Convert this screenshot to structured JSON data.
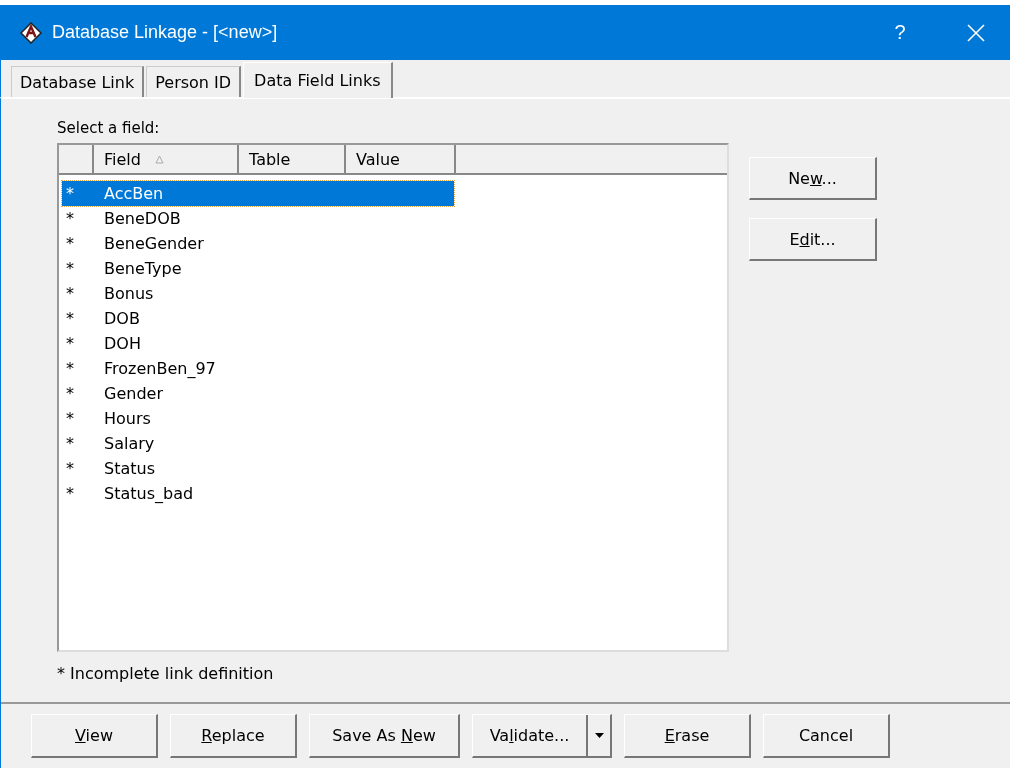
{
  "window": {
    "title": "Database Linkage - [<new>]",
    "help": "?"
  },
  "tabs": [
    {
      "label": "Database Link",
      "selected": false
    },
    {
      "label": "Person ID",
      "selected": false
    },
    {
      "label": "Data Field Links",
      "selected": true
    }
  ],
  "list_label": "Select a field:",
  "table": {
    "columns": [
      {
        "sorted": false
      },
      {
        "label": "Field",
        "sorted": true
      },
      {
        "label": "Table",
        "sorted": false
      },
      {
        "label": "Value",
        "sorted": false
      }
    ],
    "rows": [
      {
        "marker": "*",
        "field": "AccBen",
        "selected": true
      },
      {
        "marker": "*",
        "field": "BeneDOB",
        "selected": false
      },
      {
        "marker": "*",
        "field": "BeneGender",
        "selected": false
      },
      {
        "marker": "*",
        "field": "BeneType",
        "selected": false
      },
      {
        "marker": "*",
        "field": "Bonus",
        "selected": false
      },
      {
        "marker": "*",
        "field": "DOB",
        "selected": false
      },
      {
        "marker": "*",
        "field": "DOH",
        "selected": false
      },
      {
        "marker": "*",
        "field": "FrozenBen_97",
        "selected": false
      },
      {
        "marker": "*",
        "field": "Gender",
        "selected": false
      },
      {
        "marker": "*",
        "field": "Hours",
        "selected": false
      },
      {
        "marker": "*",
        "field": "Salary",
        "selected": false
      },
      {
        "marker": "*",
        "field": "Status",
        "selected": false
      },
      {
        "marker": "*",
        "field": "Status_bad",
        "selected": false
      }
    ]
  },
  "side_buttons": [
    {
      "before": "Ne",
      "key": "w",
      "after": "..."
    },
    {
      "before": "E",
      "key": "d",
      "after": "it..."
    }
  ],
  "footnote": "* Incomplete link definition",
  "bottom_buttons": [
    {
      "key": "V",
      "after": "iew",
      "kind": "plain"
    },
    {
      "key": "R",
      "after": "eplace",
      "kind": "plain"
    },
    {
      "before": "Save As ",
      "key": "N",
      "after": "ew",
      "kind": "plain"
    },
    {
      "before": "Va",
      "key": "l",
      "after": "idate...",
      "kind": "split"
    },
    {
      "key": "E",
      "after": "rase",
      "kind": "plain"
    },
    {
      "before": "Cancel",
      "kind": "plain"
    }
  ]
}
